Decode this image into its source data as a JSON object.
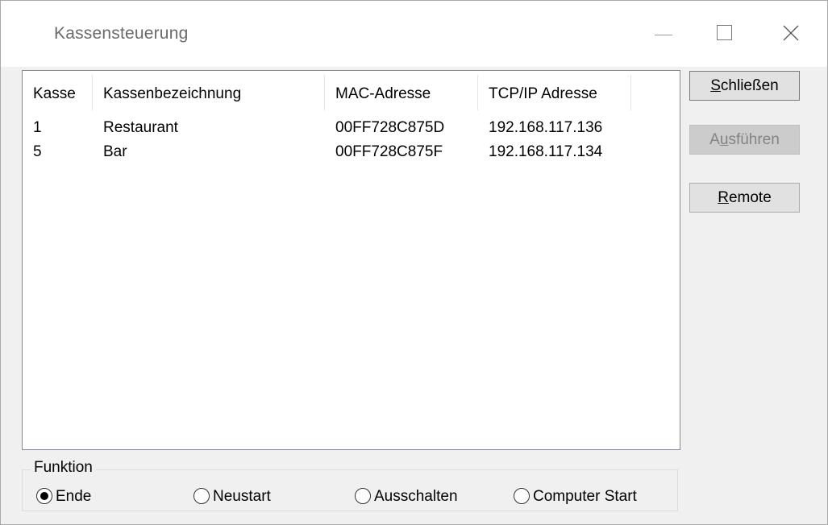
{
  "window": {
    "title": "Kassensteuerung"
  },
  "list": {
    "columns": [
      "Kasse",
      "Kassenbezeichnung",
      "MAC-Adresse",
      "TCP/IP Adresse"
    ],
    "rows": [
      [
        "1",
        "Restaurant",
        "00FF728C875D",
        "192.168.117.136"
      ],
      [
        "5",
        "Bar",
        "00FF728C875F",
        "192.168.117.134"
      ]
    ]
  },
  "buttons": {
    "close": {
      "prefix": "",
      "mnemonic": "S",
      "rest": "chließen"
    },
    "execute": {
      "prefix": "A",
      "mnemonic": "u",
      "rest": "sführen"
    },
    "remote": {
      "prefix": "",
      "mnemonic": "R",
      "rest": "emote"
    }
  },
  "function_group": {
    "legend": "Funktion",
    "options": [
      "Ende",
      "Neustart",
      "Ausschalten",
      "Computer Start"
    ],
    "selected": "Ende"
  }
}
